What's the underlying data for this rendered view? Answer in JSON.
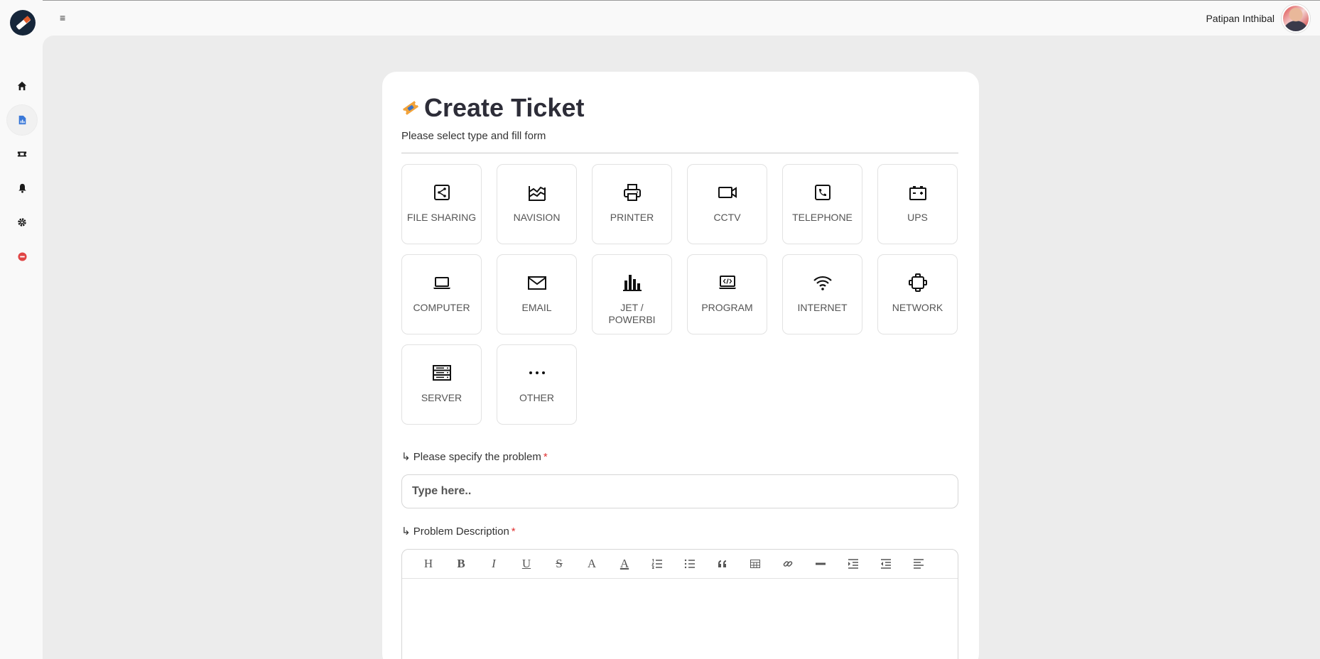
{
  "header": {
    "user_name": "Patipan Inthibal",
    "menu_icon": "≡"
  },
  "sidebar": {
    "items": [
      {
        "icon": "home-icon"
      },
      {
        "icon": "report-icon",
        "active": true
      },
      {
        "icon": "ticket-icon"
      },
      {
        "icon": "bell-icon"
      },
      {
        "icon": "gear-icon"
      },
      {
        "icon": "logout-icon"
      }
    ]
  },
  "page": {
    "title": "Create Ticket",
    "subtitle": "Please select type and fill form"
  },
  "types": [
    {
      "label": "FILE SHARING",
      "icon": "share-icon"
    },
    {
      "label": "NAVISION",
      "icon": "chart-area-icon"
    },
    {
      "label": "PRINTER",
      "icon": "printer-icon"
    },
    {
      "label": "CCTV",
      "icon": "camera-icon"
    },
    {
      "label": "TELEPHONE",
      "icon": "phone-icon"
    },
    {
      "label": "UPS",
      "icon": "battery-icon"
    },
    {
      "label": "COMPUTER",
      "icon": "laptop-icon"
    },
    {
      "label": "EMAIL",
      "icon": "envelope-icon"
    },
    {
      "label": "JET / POWERBI",
      "icon": "bar-chart-icon"
    },
    {
      "label": "PROGRAM",
      "icon": "code-laptop-icon"
    },
    {
      "label": "INTERNET",
      "icon": "wifi-icon"
    },
    {
      "label": "NETWORK",
      "icon": "network-icon"
    },
    {
      "label": "SERVER",
      "icon": "server-icon"
    },
    {
      "label": "OTHER",
      "icon": "dots-icon"
    }
  ],
  "form": {
    "problem_label": "↳ Please specify the problem",
    "problem_placeholder": "Type here..",
    "description_label": "↳ Problem Description",
    "required_mark": "*"
  },
  "editor_toolbar": {
    "heading": "H",
    "bold": "B",
    "italic": "I",
    "underline": "U",
    "strike": "S",
    "font_color": "A",
    "highlight": "A"
  }
}
